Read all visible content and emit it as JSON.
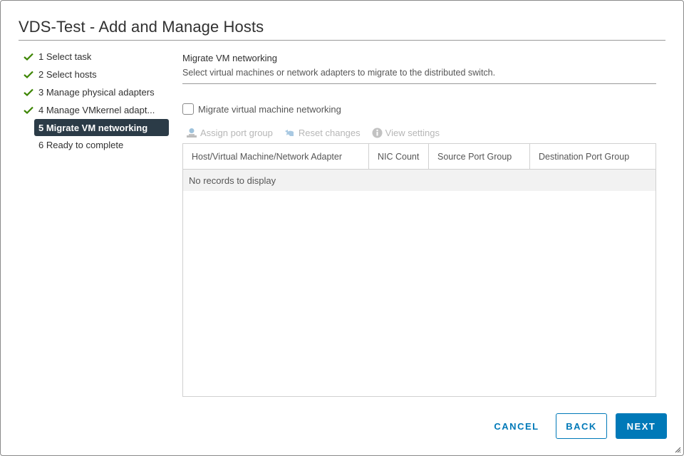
{
  "dialog": {
    "title": "VDS-Test - Add and Manage Hosts"
  },
  "steps": [
    {
      "label": "1 Select task",
      "status": "complete"
    },
    {
      "label": "2 Select hosts",
      "status": "complete"
    },
    {
      "label": "3 Manage physical adapters",
      "status": "complete"
    },
    {
      "label": "4 Manage VMkernel adapt...",
      "status": "complete"
    },
    {
      "label": "5 Migrate VM networking",
      "status": "active"
    },
    {
      "label": "6 Ready to complete",
      "status": "pending"
    }
  ],
  "content": {
    "title": "Migrate VM networking",
    "description": "Select virtual machines or network adapters to migrate to the distributed switch.",
    "checkbox": {
      "label": "Migrate virtual machine networking",
      "checked": false
    },
    "toolbar": {
      "assign": {
        "label": "Assign port group",
        "icon": "assign-port-group-icon",
        "enabled": false
      },
      "reset": {
        "label": "Reset changes",
        "icon": "undo-icon",
        "enabled": false
      },
      "view": {
        "label": "View settings",
        "icon": "info-icon",
        "enabled": false
      }
    },
    "grid": {
      "columns": [
        "Host/Virtual Machine/Network Adapter",
        "NIC Count",
        "Source Port Group",
        "Destination Port Group"
      ],
      "empty_message": "No records to display"
    }
  },
  "footer": {
    "cancel": "CANCEL",
    "back": "BACK",
    "next": "NEXT"
  },
  "colors": {
    "accent": "#0079b8",
    "active_step_bg": "#2b3b47",
    "check_green": "#3c8500"
  }
}
